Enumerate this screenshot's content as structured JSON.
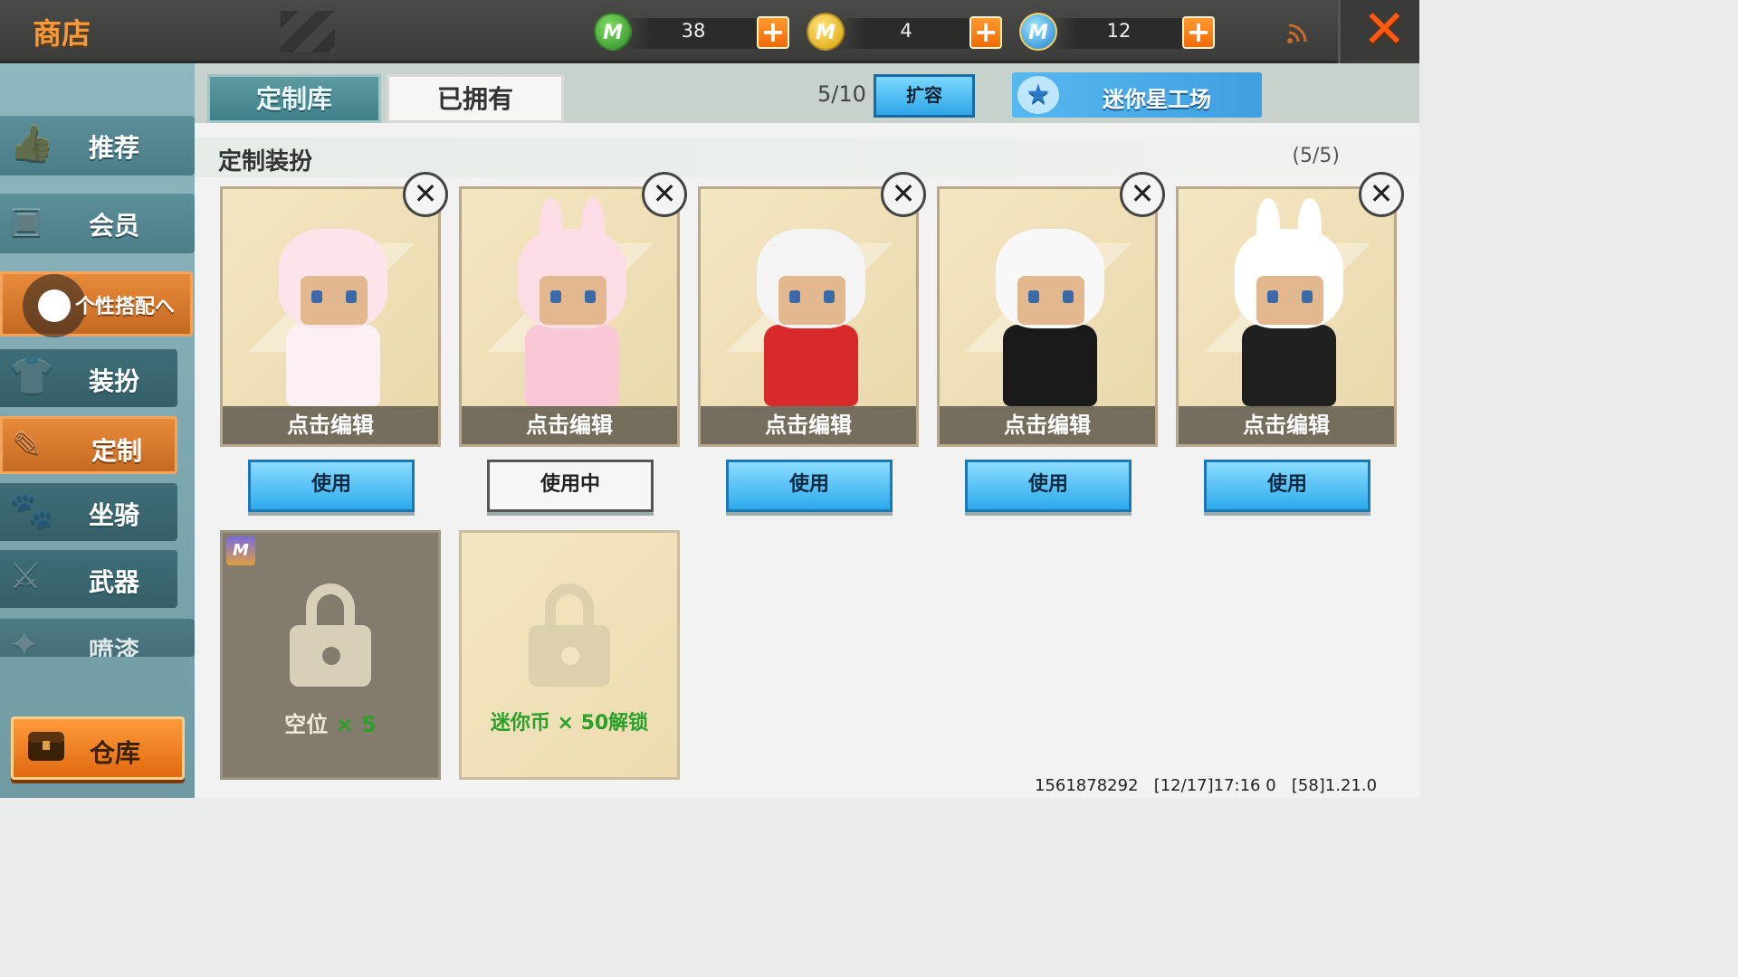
{
  "header": {
    "title": "商店",
    "currencies": [
      {
        "icon": "mini-bean-icon",
        "glyph": "M",
        "amount": "38",
        "color": "#3aa83a"
      },
      {
        "icon": "gold-coin-icon",
        "glyph": "M",
        "amount": "4",
        "color": "#e0b000"
      },
      {
        "icon": "mini-coin-icon",
        "glyph": "M",
        "amount": "12",
        "color": "#2a90e0"
      }
    ],
    "plus_glyph": "+",
    "close_glyph": "✕"
  },
  "sidebar": {
    "items": [
      {
        "label": "推荐",
        "icon": "thumbs-up-icon",
        "glyph": "👍"
      },
      {
        "label": "会员",
        "icon": "vip-icon",
        "glyph": "▣"
      },
      {
        "label": "个性搭配へ",
        "icon": "outfit-toggle-icon",
        "glyph": ""
      },
      {
        "label": "装扮",
        "icon": "shirt-icon",
        "glyph": "👕"
      },
      {
        "label": "定制",
        "icon": "brush-icon",
        "glyph": "✎"
      },
      {
        "label": "坐骑",
        "icon": "mount-icon",
        "glyph": "🐾"
      },
      {
        "label": "武器",
        "icon": "gun-icon",
        "glyph": "⚔"
      },
      {
        "label": "喷漆",
        "icon": "spray-icon",
        "glyph": "✦"
      }
    ],
    "warehouse_label": "仓库"
  },
  "tabs": {
    "custom_library": "定制库",
    "owned": "已拥有",
    "slot_count": "5/10",
    "expand": "扩容",
    "studio": "迷你星工场"
  },
  "section": {
    "title": "定制装扮",
    "count": "(5/5)"
  },
  "outfits": [
    {
      "edit_label": "点击编辑",
      "action": "使用",
      "in_use": false,
      "hair": "#fbe4ea",
      "body": "#fdf0f4",
      "ears": false
    },
    {
      "edit_label": "点击编辑",
      "action": "使用中",
      "in_use": true,
      "hair": "#fcdde6",
      "body": "#f8c8d6",
      "ears": true
    },
    {
      "edit_label": "点击编辑",
      "action": "使用",
      "in_use": false,
      "hair": "#f4f4f4",
      "body": "#d82a2a",
      "ears": false
    },
    {
      "edit_label": "点击编辑",
      "action": "使用",
      "in_use": false,
      "hair": "#f8f8f8",
      "body": "#1a1a1a",
      "ears": false
    },
    {
      "edit_label": "点击编辑",
      "action": "使用",
      "in_use": false,
      "hair": "#ffffff",
      "body": "#202020",
      "ears": true
    }
  ],
  "slots": {
    "empty_label": "空位",
    "empty_mult": "× 5",
    "badge_glyph": "M",
    "unlock_label": "迷你币 × 50解锁"
  },
  "footer": {
    "uid": "1561878292",
    "time": "[12/17]17:16 0",
    "version": "[58]1.21.0"
  }
}
